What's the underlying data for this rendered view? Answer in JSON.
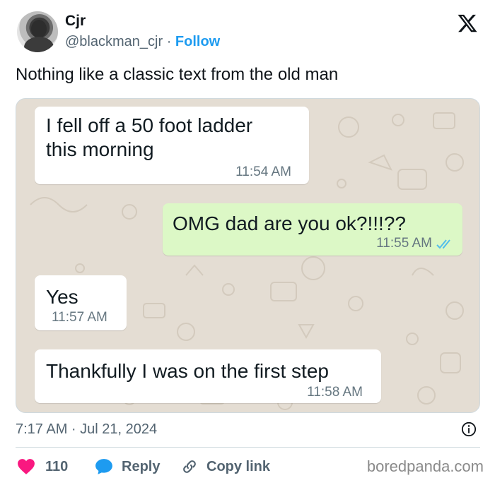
{
  "author": {
    "display_name": "Cjr",
    "handle": "@blackman_cjr",
    "separator": "·",
    "follow_label": "Follow"
  },
  "tweet": {
    "text": "Nothing like a classic text from the old man",
    "date": "7:17 AM · Jul 21, 2024"
  },
  "screenshot": {
    "messages": [
      {
        "direction": "incoming",
        "lines": [
          "I fell off a 50 foot ladder",
          "this morning"
        ],
        "time": "11:54 AM"
      },
      {
        "direction": "outgoing",
        "text": "OMG dad are you ok?!!!??",
        "time": "11:55 AM",
        "status": "read"
      },
      {
        "direction": "incoming",
        "text": "Yes",
        "time": "11:57 AM"
      },
      {
        "direction": "incoming",
        "text": "Thankfully I was on the first step",
        "time": "11:58 AM"
      }
    ],
    "colors": {
      "chat_background": "#e4ddd3",
      "incoming_bubble": "#ffffff",
      "outgoing_bubble": "#dcf8c6",
      "read_ticks": "#53bdeb"
    }
  },
  "actions": {
    "like_count": "110",
    "reply_label": "Reply",
    "copy_link_label": "Copy link"
  },
  "watermark": "boredpanda.com",
  "colors": {
    "accent": "#1d9bf0",
    "like": "#f91880",
    "secondary_text": "#536471"
  },
  "icons": [
    "x-logo-icon",
    "info-icon",
    "heart-icon",
    "reply-bubble-icon",
    "link-icon",
    "double-check-icon"
  ]
}
